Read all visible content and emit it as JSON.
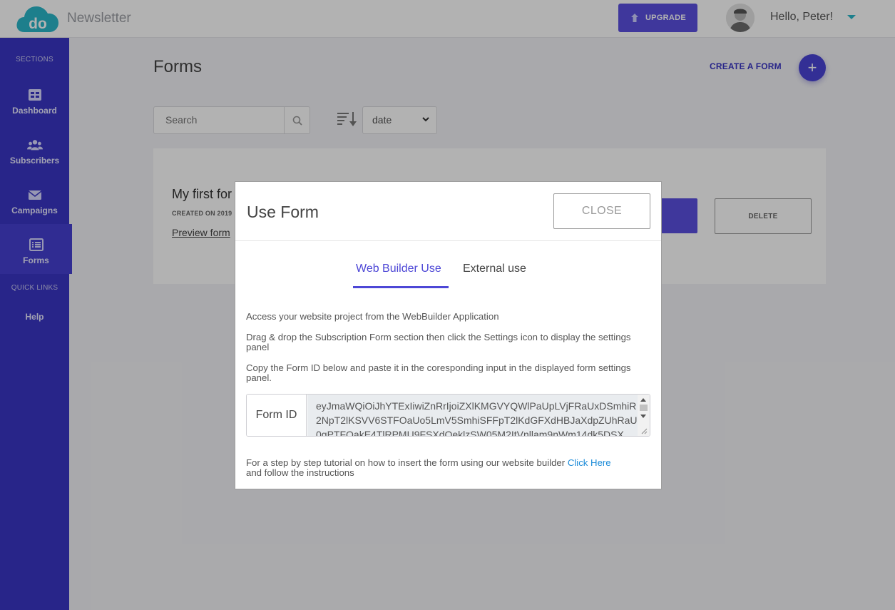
{
  "header": {
    "app_title": "Newsletter",
    "upgrade_label": "UPGRADE",
    "greeting": "Hello, Peter!"
  },
  "sidebar": {
    "sections_label": "SECTIONS",
    "items": [
      {
        "label": "Dashboard",
        "icon": "dashboard-icon"
      },
      {
        "label": "Subscribers",
        "icon": "users-icon"
      },
      {
        "label": "Campaigns",
        "icon": "envelope-icon"
      },
      {
        "label": "Forms",
        "icon": "list-icon",
        "active": true
      }
    ],
    "quick_links_label": "QUICK LINKS",
    "help_label": "Help"
  },
  "main": {
    "title": "Forms",
    "create_label": "CREATE A FORM",
    "search_placeholder": "Search",
    "sort_value": "date",
    "card": {
      "title": "My first for",
      "created": "CREATED ON 2019",
      "preview_label": "Preview form",
      "delete_label": "DELETE"
    }
  },
  "modal": {
    "title": "Use Form",
    "close_label": "CLOSE",
    "tabs": [
      {
        "label": "Web Builder Use",
        "active": true
      },
      {
        "label": "External use",
        "active": false
      }
    ],
    "step1": "Access your website project from the WebBuilder Application",
    "step2": "Drag & drop the Subscription Form section then click the Settings icon to display the settings panel",
    "step3": "Copy the Form ID below and paste it in the coresponding input in the displayed form settings panel.",
    "form_id_label": "Form ID",
    "form_id_value": "eyJmaWQiOiJhYTExIiwiZnRrIjoiZXlKMGVYQWlPaUpLVjFRaUxDSmhiR2NpT2lKSVV6STFOaUo5LmV5SmhiSFFpT2lKdGFXdHBJaXdpZUhRaU0gPTFOakE4TlRPMU9FSXdOeklzSW05M2ItVnllam9nWm14dk5DSX",
    "tutorial_text": "For a step by step tutorial on how to insert the form using our website builder",
    "tutorial_link": "Click Here",
    "tutorial_after": "and follow the instructions"
  },
  "colors": {
    "brand": "#3a36c4",
    "accent": "#5b4fe0",
    "link": "#1b8bd8"
  }
}
